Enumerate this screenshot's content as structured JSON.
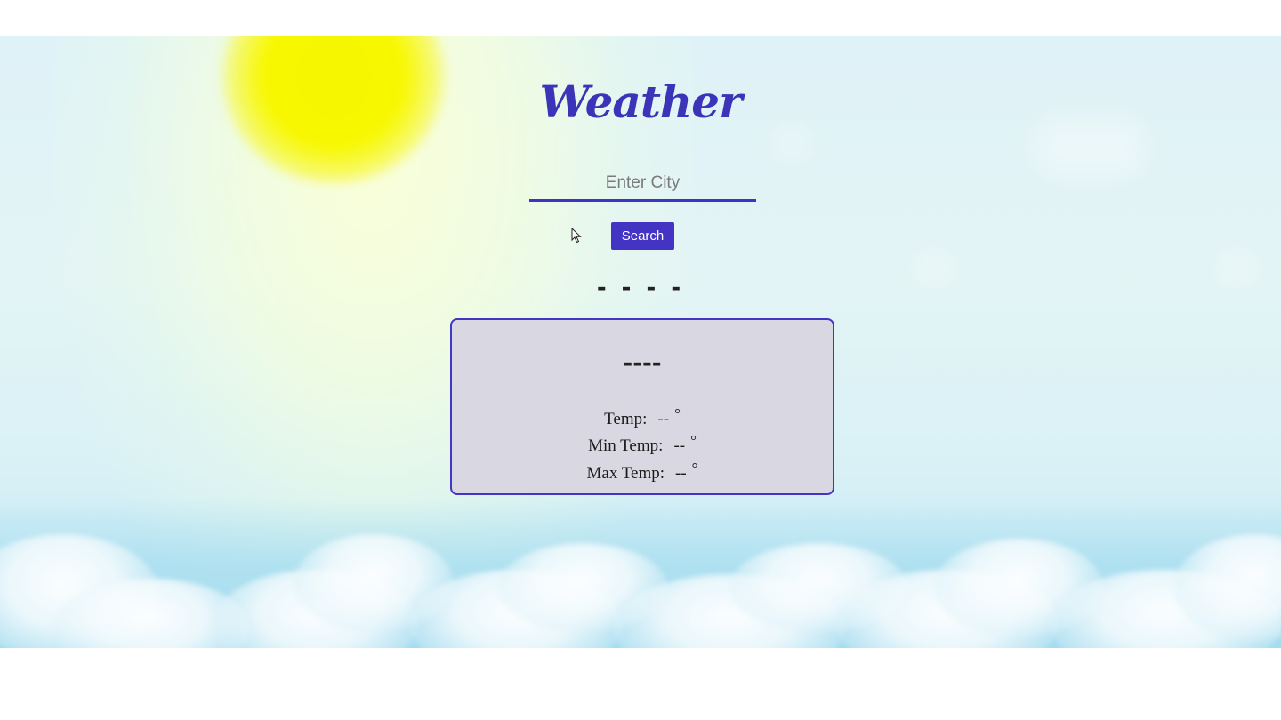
{
  "app": {
    "title": "Weather"
  },
  "search": {
    "placeholder": "Enter City",
    "value": "",
    "button_label": "Search"
  },
  "result": {
    "city": "- - - -",
    "description": "----",
    "rows": [
      {
        "label": "Temp:",
        "value": "--",
        "unit": "°"
      },
      {
        "label": "Min Temp:",
        "value": "--",
        "unit": "°"
      },
      {
        "label": "Max Temp:",
        "value": "--",
        "unit": "°"
      }
    ]
  },
  "colors": {
    "accent": "#4434c4",
    "title": "#3b34b8",
    "card_bg": "#d8d7e2",
    "sun": "#f7f700",
    "sky": "#dff2f7"
  },
  "icons": {
    "sun": "sun-icon",
    "cursor": "mouse-pointer-icon"
  }
}
